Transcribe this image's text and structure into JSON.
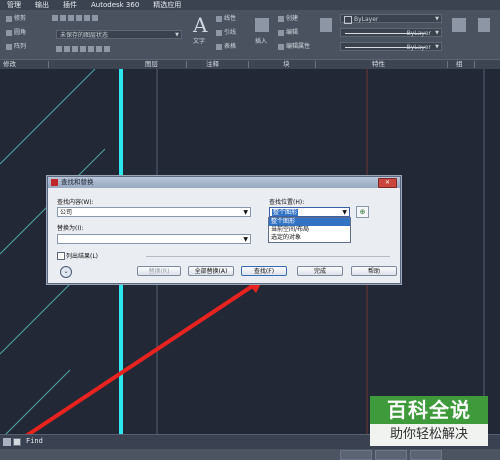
{
  "menu": [
    "管理",
    "输出",
    "插件",
    "Autodesk 360",
    "精选应用"
  ],
  "ribbon": {
    "modify_items": [
      "修剪",
      "圆角",
      "阵列"
    ],
    "layer_dropdown": "未保存的图层状态",
    "annotation_items": [
      "线性",
      "引线",
      "表格"
    ],
    "text_label": "文字",
    "block_items": [
      "创建",
      "编辑",
      "编辑属性"
    ],
    "insert_label": "插入",
    "properties": [
      "ByLayer",
      "ByLayer",
      "ByLayer"
    ],
    "panels": [
      "修改",
      "图层",
      "注释",
      "块",
      "特性",
      "组"
    ]
  },
  "dialog": {
    "title": "查找和替换",
    "find_label": "查找内容(W):",
    "find_value": "公司",
    "replace_label": "替换为(I):",
    "replace_value": "",
    "location_label": "查找位置(H):",
    "location_value": "整个图形",
    "location_options": [
      "整个图形",
      "当前空间/布局",
      "选定的对象"
    ],
    "list_results_label": "列出结果(L)",
    "buttons": {
      "replace": "替换(R)",
      "replace_all": "全部替换(A)",
      "find": "查找(F)",
      "done": "完成",
      "help": "帮助"
    },
    "close_glyph": "✕"
  },
  "command_line": {
    "text": "Find"
  },
  "watermark": {
    "line1": "百科全说",
    "line2": "助你轻松解决"
  },
  "colors": {
    "canvas": "#222836",
    "cyan_line": "#2ee6ee",
    "arrow": "#e8231f",
    "watermark_green": "#3e9a3a"
  }
}
